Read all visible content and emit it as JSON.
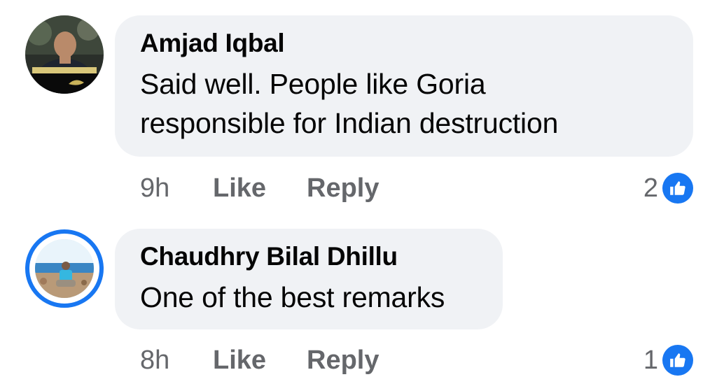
{
  "comments": [
    {
      "author": "Amjad Iqbal",
      "text_line1": "Said well. People like Goria",
      "text_line2": "responsible for Indian destruction",
      "time": "9h",
      "like_label": "Like",
      "reply_label": "Reply",
      "reaction_count": "2",
      "reaction_icon": "thumbs-up-icon"
    },
    {
      "author": "Chaudhry Bilal Dhillu",
      "text_line1": "One of the best remarks",
      "time": "8h",
      "like_label": "Like",
      "reply_label": "Reply",
      "reaction_count": "1",
      "reaction_icon": "thumbs-up-icon",
      "has_story_ring": true
    }
  ],
  "colors": {
    "bubble": "#f0f2f5",
    "accent": "#1877f2",
    "secondary_text": "#65676b",
    "primary_text": "#050505"
  }
}
